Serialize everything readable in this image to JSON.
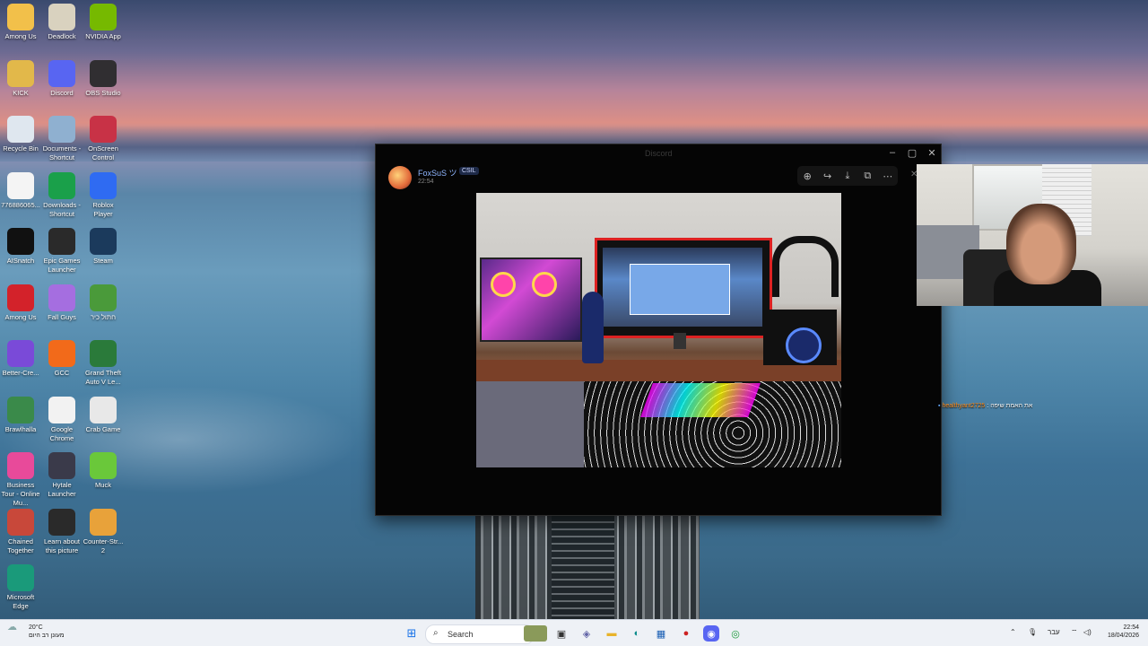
{
  "desktop": {
    "icons": [
      {
        "label": "Among Us",
        "icon": "folder-icon",
        "color": "#f2c04a"
      },
      {
        "label": "Deadlock",
        "icon": "deadlock-icon",
        "color": "#d9d2bf"
      },
      {
        "label": "NVIDIA App",
        "icon": "nvidia-icon",
        "color": "#76b900"
      },
      {
        "label": "KICK",
        "icon": "kick-icon",
        "color": "#e2b84a"
      },
      {
        "label": "Discord",
        "icon": "discord-icon",
        "color": "#5865f2"
      },
      {
        "label": "OBS Studio",
        "icon": "obs-icon",
        "color": "#302e31"
      },
      {
        "label": "Recycle Bin",
        "icon": "recycle-bin-icon",
        "color": "#dfe7ef"
      },
      {
        "label": "Documents - Shortcut",
        "icon": "documents-icon",
        "color": "#8fb0d0"
      },
      {
        "label": "OnScreen Control",
        "icon": "onscreen-control-icon",
        "color": "#c83246"
      },
      {
        "label": "776886065...",
        "icon": "file-icon",
        "color": "#f4f4f4"
      },
      {
        "label": "Downloads - Shortcut",
        "icon": "downloads-icon",
        "color": "#1aa04a"
      },
      {
        "label": "Roblox Player",
        "icon": "roblox-icon",
        "color": "#2f6bf2"
      },
      {
        "label": "AISnatch",
        "icon": "aisnatch-icon",
        "color": "#111111"
      },
      {
        "label": "Epic Games Launcher",
        "icon": "epic-games-icon",
        "color": "#2a2a2a"
      },
      {
        "label": "Steam",
        "icon": "steam-icon",
        "color": "#1b3a5c"
      },
      {
        "label": "Among Us",
        "icon": "among-us-icon",
        "color": "#d3222a"
      },
      {
        "label": "Fall Guys",
        "icon": "fall-guys-icon",
        "color": "#a56ee0"
      },
      {
        "label": "חתול כיר",
        "icon": "game-icon",
        "color": "#4a9a3a"
      },
      {
        "label": "Better-Cre...",
        "icon": "better-crewlink-icon",
        "color": "#7a4ad8"
      },
      {
        "label": "GCC",
        "icon": "gcc-icon",
        "color": "#f26a1a"
      },
      {
        "label": "Grand Theft Auto V Le...",
        "icon": "gta-icon",
        "color": "#2a7a3a"
      },
      {
        "label": "Brawlhalla",
        "icon": "brawlhalla-icon",
        "color": "#3a8a4a"
      },
      {
        "label": "Google Chrome",
        "icon": "chrome-icon",
        "color": "#f2f2f2"
      },
      {
        "label": "Crab Game",
        "icon": "crab-game-icon",
        "color": "#e8e8e8"
      },
      {
        "label": "Business Tour - Online Mu...",
        "icon": "business-tour-icon",
        "color": "#e84a9a"
      },
      {
        "label": "Hytale Launcher",
        "icon": "hytale-icon",
        "color": "#3a3a4a"
      },
      {
        "label": "Muck",
        "icon": "muck-icon",
        "color": "#6ac83a"
      },
      {
        "label": "Chained Together",
        "icon": "chained-together-icon",
        "color": "#c8483a"
      },
      {
        "label": "Learn about this picture",
        "icon": "learn-about-picture-icon",
        "color": "#2a2a2a"
      },
      {
        "label": "Counter-Str... 2",
        "icon": "cs2-icon",
        "color": "#e8a23a"
      },
      {
        "label": "Microsoft Edge",
        "icon": "edge-icon",
        "color": "#1a9a7a"
      }
    ]
  },
  "viewer": {
    "window_title": "Discord",
    "author_name": "FoxSuS ツ",
    "author_badge": "CSIL",
    "timestamp": "22:54",
    "toolbar": [
      "zoom-in-icon",
      "share-icon",
      "download-icon",
      "open-external-icon",
      "more-icon"
    ]
  },
  "overlay_chat": {
    "username": "healthyant2725",
    "message": "את האמת שיפה"
  },
  "taskbar": {
    "weather_temp": "20°C",
    "weather_text": "מעונן רב היום",
    "search_label": "Search",
    "language": "עבר",
    "time": "22:54",
    "date": "18/04/2026"
  }
}
